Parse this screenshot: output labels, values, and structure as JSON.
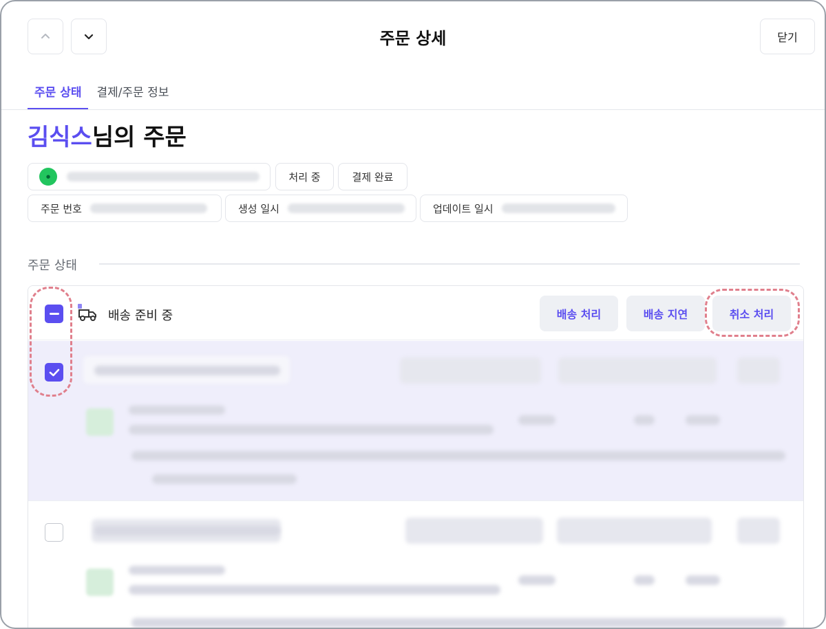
{
  "header": {
    "prev_icon": "chevron-up-icon",
    "next_icon": "chevron-down-icon",
    "title": "주문 상세",
    "close_label": "닫기"
  },
  "tabs": [
    {
      "label": "주문 상태",
      "active": true
    },
    {
      "label": "결제/주문 정보",
      "active": false
    }
  ],
  "customer": {
    "name": "김식스",
    "suffix": "님의 주문"
  },
  "chips": {
    "status": "처리 중",
    "payment": "결제 완료",
    "order_number_label": "주문 번호",
    "created_label": "생성 일시",
    "updated_label": "업데이트 일시"
  },
  "section": {
    "title": "주문 상태"
  },
  "group": {
    "status_label": "배송 준비 중",
    "actions": [
      "배송 처리",
      "배송 지연",
      "취소 처리"
    ]
  },
  "colors": {
    "accent": "#5b4ef0",
    "highlight_dashed": "#e07f8c",
    "selected_row_bg": "#efeefb"
  }
}
